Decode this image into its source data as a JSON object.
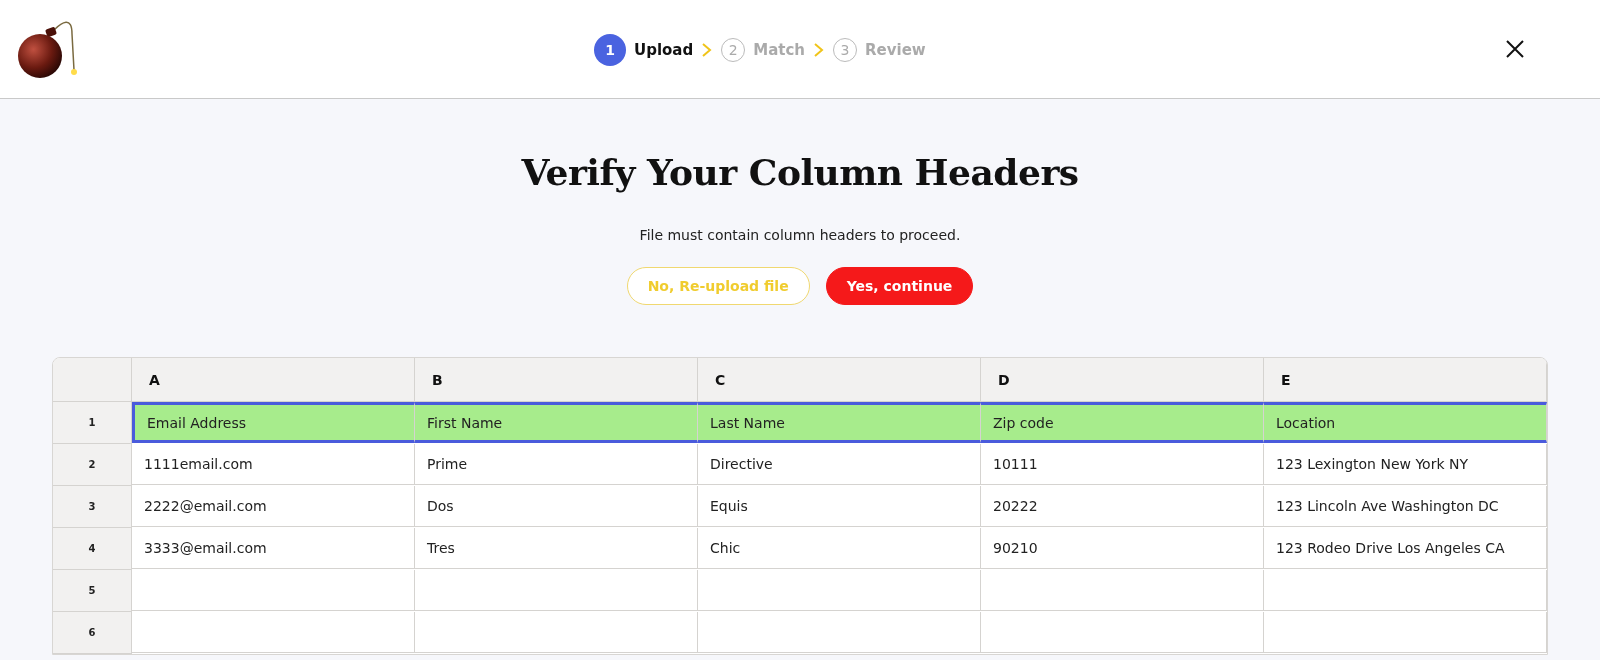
{
  "steps": [
    {
      "number": "1",
      "label": "Upload",
      "selected": true
    },
    {
      "number": "2",
      "label": "Match",
      "selected": false
    },
    {
      "number": "3",
      "label": "Review",
      "selected": false
    }
  ],
  "title": "Verify Your Column Headers",
  "subtitle": "File must contain column headers to proceed.",
  "buttons": [
    {
      "label": "No, Re-upload file",
      "kind": "secondary"
    },
    {
      "label": "Yes, continue",
      "kind": "primary"
    }
  ],
  "table": {
    "columns": [
      "A",
      "B",
      "C",
      "D",
      "E"
    ],
    "rows": [
      {
        "number": "1",
        "selected": true,
        "cells": [
          "Email Address",
          "First Name",
          "Last Name",
          "Zip code",
          "Location"
        ]
      },
      {
        "number": "2",
        "selected": false,
        "cells": [
          "1111email.com",
          "Prime",
          "Directive",
          "10111",
          "123 Lexington New York NY"
        ]
      },
      {
        "number": "3",
        "selected": false,
        "cells": [
          "2222@email.com",
          "Dos",
          "Equis",
          "20222",
          "123 Lincoln Ave Washington DC"
        ]
      },
      {
        "number": "4",
        "selected": false,
        "cells": [
          "3333@email.com",
          "Tres",
          "Chic",
          "90210",
          "123 Rodeo Drive Los Angeles CA"
        ]
      },
      {
        "number": "5",
        "selected": false,
        "cells": []
      },
      {
        "number": "6",
        "selected": false,
        "cells": []
      }
    ]
  }
}
